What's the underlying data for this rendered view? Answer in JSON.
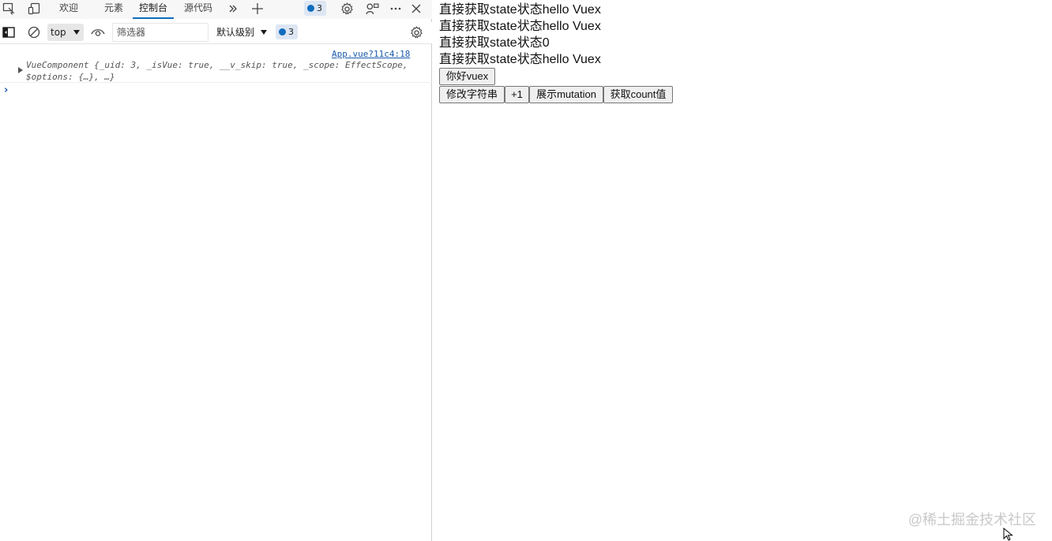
{
  "devtools": {
    "tabs": [
      {
        "label": "欢迎"
      },
      {
        "label": "元素"
      },
      {
        "label": "控制台"
      },
      {
        "label": "源代码"
      }
    ],
    "issue_count": "3",
    "toolbar": {
      "context": "top",
      "filter_placeholder": "筛选器",
      "level": "默认级别",
      "issue_count": "3"
    },
    "console": {
      "source_link": "App.vue?11c4:18",
      "object_preview": "VueComponent {_uid: 3, _isVue: true, __v_skip: true, _scope: EffectScope,\n$options: {…}, …}"
    },
    "accent_color": "#0f6cbd"
  },
  "page": {
    "lines": [
      "直接获取state状态hello Vuex",
      "直接获取state状态hello Vuex",
      "直接获取state状态0",
      "直接获取state状态hello Vuex"
    ],
    "buttons": {
      "hello": "你好vuex",
      "modify": "修改字符串",
      "plus_one": "+1",
      "show_mutation": "展示mutation",
      "get_count": "获取count值"
    }
  },
  "watermark": "@稀土掘金技术社区"
}
